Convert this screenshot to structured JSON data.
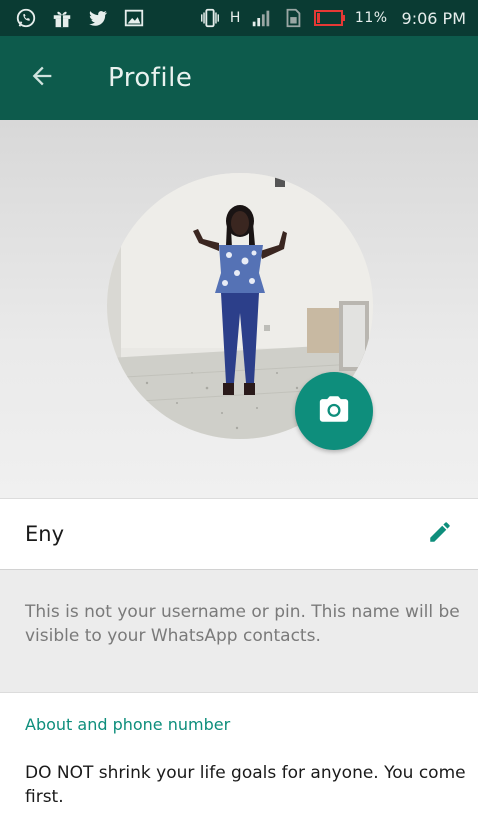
{
  "status_bar": {
    "left_icons": [
      "whatsapp-icon",
      "gift-icon",
      "twitter-icon",
      "image-icon"
    ],
    "right_icons": [
      "vibrate-icon",
      "signal-icon",
      "sim-icon",
      "battery-icon"
    ],
    "network_label": "H",
    "battery_percent": "11%",
    "battery_level": 0.11,
    "time": "9:06 PM"
  },
  "app_bar": {
    "title": "Profile",
    "back_icon": "arrow-left-icon"
  },
  "profile": {
    "photo_icon": "camera-icon",
    "name": "Eny",
    "edit_icon": "pencil-icon",
    "hint": "This is not your username or pin. This name will be visible to your WhatsApp contacts.",
    "about_heading": "About and phone number",
    "about_text": "DO NOT shrink your life goals for anyone. You come first."
  },
  "colors": {
    "status_bar": "#0a3b33",
    "app_bar": "#0d5b4c",
    "accent": "#0e8e7c",
    "battery_low": "#e53935"
  }
}
